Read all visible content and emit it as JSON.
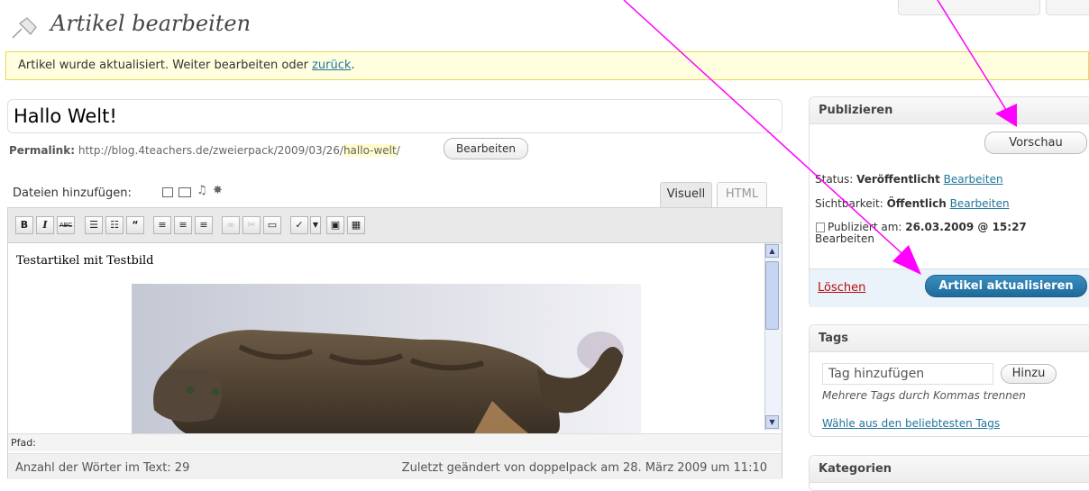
{
  "header": {
    "title": "Artikel bearbeiten",
    "icon": "pushpin-icon"
  },
  "notice": {
    "text": "Artikel wurde aktualisiert. Weiter bearbeiten oder ",
    "link": "zurück",
    "suffix": "."
  },
  "post": {
    "title_value": "Hallo Welt!",
    "permalink_label": "Permalink:",
    "permalink_base": "http://blog.4teachers.de/zweierpack/2009/03/26/",
    "permalink_slug": "hallo-welt",
    "permalink_trailing": "/",
    "permalink_edit": "Bearbeiten"
  },
  "media": {
    "label": "Dateien hinzufügen:"
  },
  "editor_tabs": {
    "visual": "Visuell",
    "html": "HTML"
  },
  "toolbar": {
    "bold": "B",
    "italic": "I",
    "strike": "ABC"
  },
  "editor": {
    "content_text": "Testartikel mit Testbild",
    "path_label": "Pfad:",
    "word_count": "Anzahl der Wörter im Text: 29",
    "last_modified": "Zuletzt geändert von doppelpack am 28. März 2009 um 11:10"
  },
  "publish": {
    "heading": "Publizieren",
    "preview": "Vorschau",
    "status_label": "Status: ",
    "status_value": "Veröffentlicht",
    "visibility_label": "Sichtbarkeit: ",
    "visibility_value": "Öffentlich",
    "published_label": "Publiziert am: ",
    "published_value": "26.03.2009 @ 15:27",
    "edit": "Bearbeiten",
    "delete": "Löschen",
    "update": "Artikel aktualisieren"
  },
  "tags": {
    "heading": "Tags",
    "placeholder": "Tag hinzufügen",
    "add": "Hinzu",
    "hint": "Mehrere Tags durch Kommas trennen",
    "popular": "Wähle aus den beliebtesten Tags"
  },
  "categories": {
    "heading": "Kategorien"
  },
  "colors": {
    "annotation_arrow": "#ff00ff",
    "primary_button": "#21759b"
  }
}
